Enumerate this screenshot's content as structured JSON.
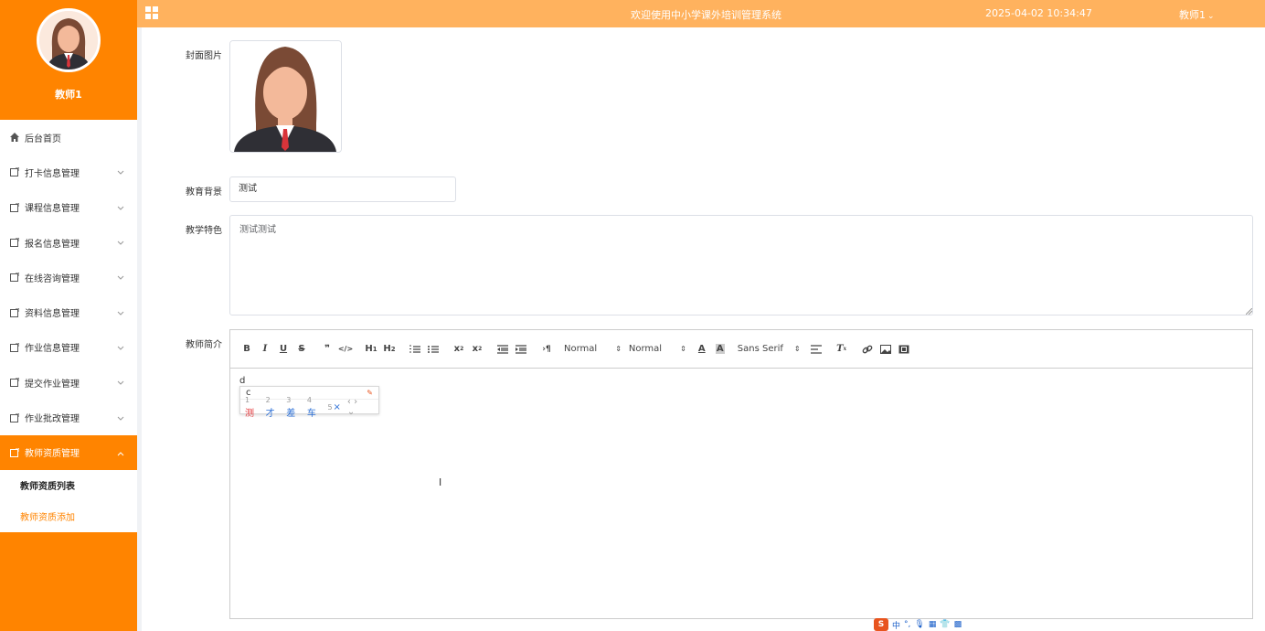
{
  "sidebar": {
    "username": "教师1",
    "items": [
      {
        "label": "后台首页",
        "icon": "home-icon",
        "has_arrow": false
      },
      {
        "label": "打卡信息管理",
        "icon": "document-icon",
        "has_arrow": true
      },
      {
        "label": "课程信息管理",
        "icon": "document-icon",
        "has_arrow": true
      },
      {
        "label": "报名信息管理",
        "icon": "document-icon",
        "has_arrow": true
      },
      {
        "label": "在线咨询管理",
        "icon": "document-icon",
        "has_arrow": true
      },
      {
        "label": "资料信息管理",
        "icon": "document-icon",
        "has_arrow": true
      },
      {
        "label": "作业信息管理",
        "icon": "document-icon",
        "has_arrow": true
      },
      {
        "label": "提交作业管理",
        "icon": "document-icon",
        "has_arrow": true
      },
      {
        "label": "作业批改管理",
        "icon": "document-icon",
        "has_arrow": true
      },
      {
        "label": "教师资质管理",
        "icon": "document-icon",
        "has_arrow": true,
        "active": true
      }
    ],
    "subitems": [
      {
        "label": "教师资质列表",
        "active": false
      },
      {
        "label": "教师资质添加",
        "active": true
      }
    ]
  },
  "topbar": {
    "title": "欢迎使用中小学课外培训管理系统",
    "datetime": "2025-04-02 10:34:47",
    "user": "教师1",
    "user_caret": "⌄"
  },
  "form": {
    "cover_label": "封面图片",
    "education_label": "教育背景",
    "education_value": "测试",
    "feature_label": "教学特色",
    "feature_value": "测试测试",
    "intro_label": "教师简介"
  },
  "editor": {
    "header_select_1": "Normal",
    "header_select_2": "Normal",
    "font_select": "Sans Serif",
    "typed_text": "d"
  },
  "ime": {
    "input": "c",
    "candidates": [
      {
        "num": "1",
        "text": "测"
      },
      {
        "num": "2",
        "text": "才"
      },
      {
        "num": "3",
        "text": "差"
      },
      {
        "num": "4",
        "text": "车"
      },
      {
        "num": "5",
        "text": "×"
      }
    ],
    "status_logo": "S",
    "status_mode": "中"
  },
  "colors": {
    "sidebar": "#ff8400",
    "topbar": "#ffb25e",
    "active_subitem": "#ff8400"
  }
}
